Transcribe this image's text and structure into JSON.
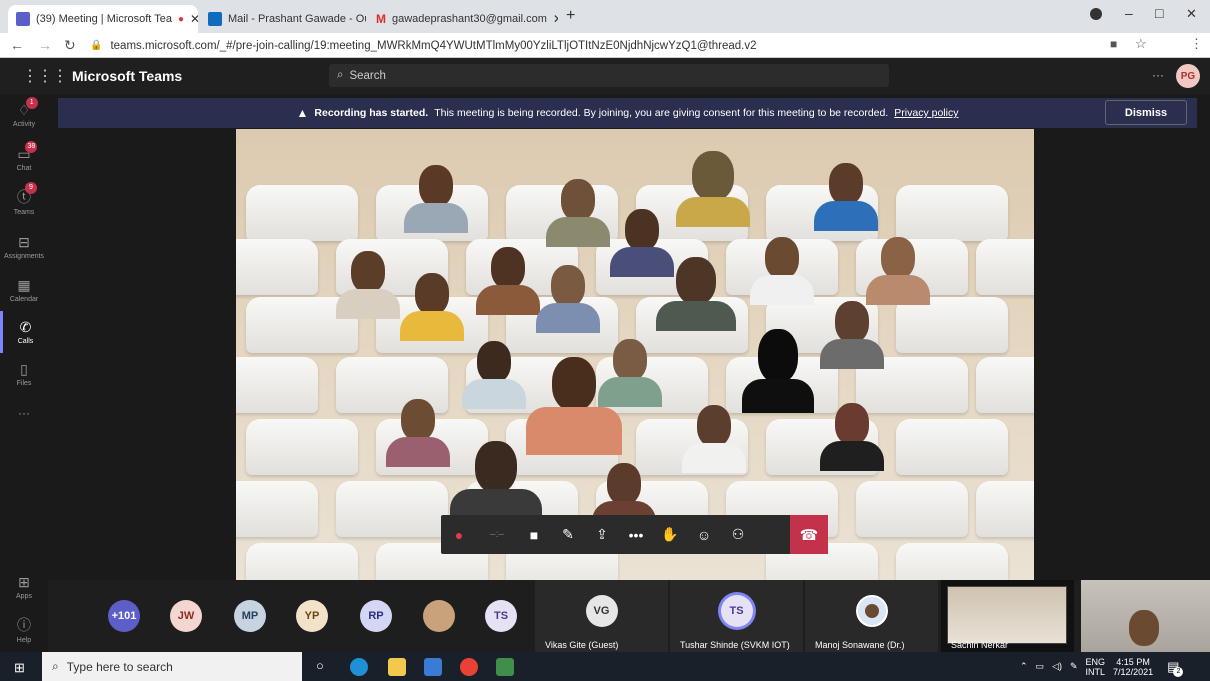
{
  "browser": {
    "tabs": [
      {
        "label": "(39) Meeting | Microsoft Tea",
        "active": true
      },
      {
        "label": "Mail - Prashant Gawade - Outloo",
        "active": false
      },
      {
        "label": "gawadeprashant30@gmail.com",
        "active": false
      }
    ],
    "url": "teams.microsoft.com/_#/pre-join-calling/19:meeting_MWRkMmQ4YWUtMTlmMy00YzliLTljOTItNzE0NjdhNjcwYzQ1@thread.v2",
    "window_controls": [
      "–",
      "□",
      "✕"
    ]
  },
  "header": {
    "brand": "Microsoft Teams",
    "search_placeholder": "Search",
    "more": "···",
    "user_initials": "PG"
  },
  "rail": {
    "items": [
      {
        "label": "Activity",
        "icon": "bell-icon",
        "badge": "1"
      },
      {
        "label": "Chat",
        "icon": "chat-icon",
        "badge": "38"
      },
      {
        "label": "Teams",
        "icon": "teams-icon",
        "badge": "9"
      },
      {
        "label": "Assignments",
        "icon": "assignments-icon",
        "badge": ""
      },
      {
        "label": "Calendar",
        "icon": "calendar-icon",
        "badge": ""
      },
      {
        "label": "Calls",
        "icon": "phone-icon",
        "badge": ""
      },
      {
        "label": "Files",
        "icon": "file-icon",
        "badge": ""
      },
      {
        "label": "···",
        "icon": "more-icon",
        "badge": ""
      }
    ],
    "bottom": [
      {
        "label": "Apps",
        "icon": "apps-icon"
      },
      {
        "label": "Help",
        "icon": "help-icon"
      }
    ]
  },
  "banner": {
    "bold": "Recording has started.",
    "text": "This meeting is being recorded. By joining, you are giving consent for this meeting to be recorded.",
    "link": "Privacy policy",
    "dismiss": "Dismiss"
  },
  "participants": {
    "overflow": "+101",
    "avatars": [
      {
        "initials": "JW",
        "bg": "#f4d6d0",
        "fg": "#8a2e22"
      },
      {
        "initials": "MP",
        "bg": "#c7d3e0",
        "fg": "#234261"
      },
      {
        "initials": "YP",
        "bg": "#f1e2c8",
        "fg": "#6b4510"
      },
      {
        "initials": "RP",
        "bg": "#d3d7f5",
        "fg": "#2b2f7a"
      },
      {
        "initials": "",
        "bg": "#c9a27b",
        "fg": "#fff"
      },
      {
        "initials": "TS",
        "bg": "#e6e1f5",
        "fg": "#4b3b8a"
      }
    ],
    "tiles": [
      {
        "name": "Vikas Gite (Guest)",
        "initials": "VG"
      },
      {
        "name": "Tushar Shinde (SVKM IOT)",
        "initials": "TS"
      },
      {
        "name": "Manoj Sonawane (Dr.)",
        "initials": ""
      },
      {
        "name": "Sachin Nerkar",
        "initials": ""
      }
    ]
  },
  "taskbar": {
    "search_placeholder": "Type here to search",
    "lang_top": "ENG",
    "lang_bottom": "INTL",
    "time": "4:15 PM",
    "date": "7/12/2021",
    "notifications": "2"
  },
  "colors": {
    "accent": "#7f85f5",
    "hangup": "#c4314b",
    "banner": "#2b2f4f"
  }
}
